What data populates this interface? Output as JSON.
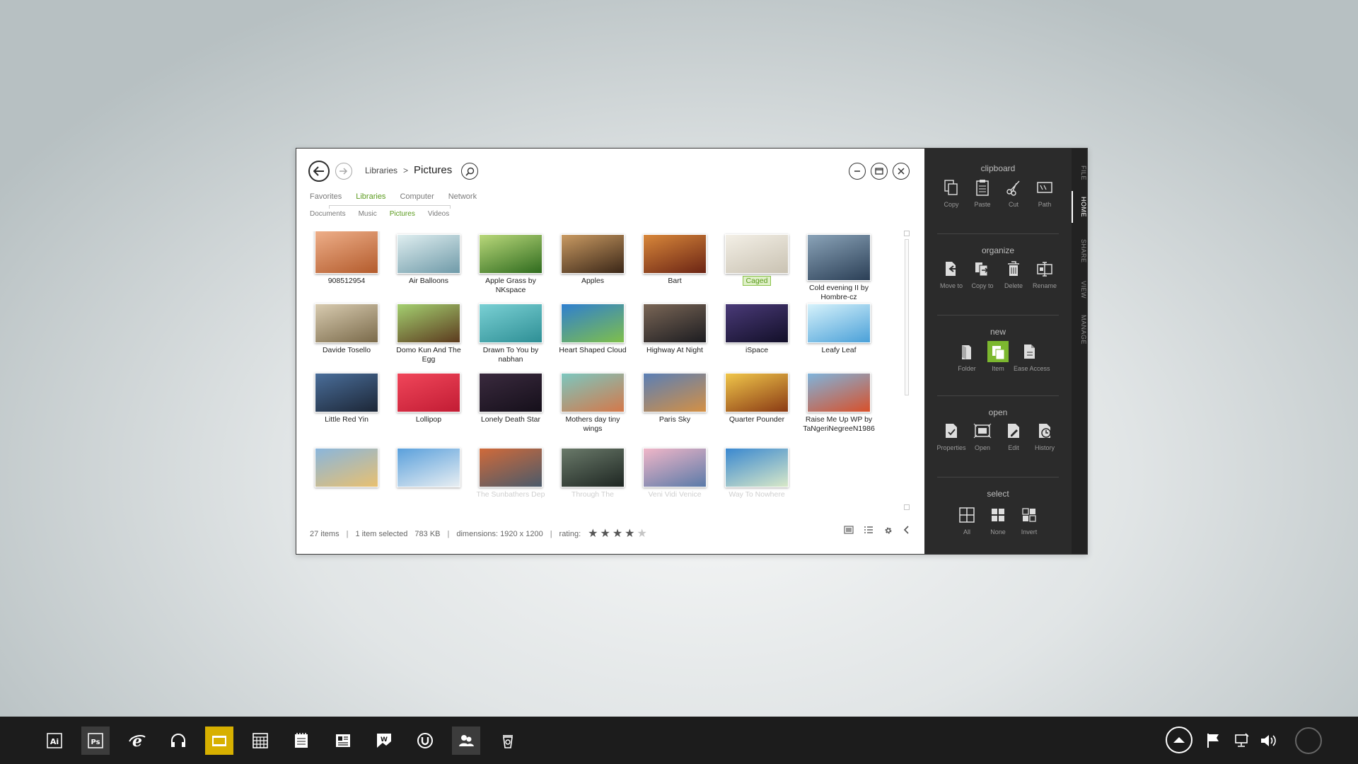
{
  "window": {
    "breadcrumb": {
      "root": "Libraries",
      "separator": ">",
      "current": "Pictures"
    },
    "tabs": [
      {
        "label": "Favorites",
        "active": false
      },
      {
        "label": "Libraries",
        "active": true
      },
      {
        "label": "Computer",
        "active": false
      },
      {
        "label": "Network",
        "active": false
      }
    ],
    "subtabs": [
      {
        "label": "Documents",
        "active": false
      },
      {
        "label": "Music",
        "active": false
      },
      {
        "label": "Pictures",
        "active": true
      },
      {
        "label": "Videos",
        "active": false
      }
    ],
    "items": [
      {
        "label": "908512954",
        "icon": "thumb-burgers",
        "colors": [
          "#f1b38e",
          "#b35b2c"
        ]
      },
      {
        "label": "Air Balloons",
        "icon": "thumb-air-balloons",
        "colors": [
          "#dfeef0",
          "#6f9aa8"
        ]
      },
      {
        "label": "Apple Grass by NKspace",
        "icon": "thumb-apple-grass",
        "colors": [
          "#b9d87a",
          "#2f6b1e"
        ]
      },
      {
        "label": "Apples",
        "icon": "thumb-apples",
        "colors": [
          "#c99a62",
          "#3a2617"
        ]
      },
      {
        "label": "Bart",
        "icon": "thumb-bart",
        "colors": [
          "#d8873a",
          "#6b2414"
        ]
      },
      {
        "label": "Caged",
        "icon": "thumb-caged",
        "colors": [
          "#f3efe6",
          "#c9c2b2"
        ],
        "selected": true
      },
      {
        "label": "Cold evening II by Hombre-cz",
        "icon": "thumb-cold-evening",
        "colors": [
          "#8aa3b8",
          "#2b3f56"
        ]
      },
      {
        "label": "Davide Tosello",
        "icon": "thumb-davide-tosello",
        "colors": [
          "#d8cbb0",
          "#7a6a4a"
        ]
      },
      {
        "label": "Domo Kun And The Egg",
        "icon": "thumb-domo-kun",
        "colors": [
          "#a4d070",
          "#5c3a1e"
        ]
      },
      {
        "label": "Drawn To You by nabhan",
        "icon": "thumb-drawn-to-you",
        "colors": [
          "#7ad0d4",
          "#2e8f95"
        ]
      },
      {
        "label": "Heart Shaped Cloud",
        "icon": "thumb-heart-cloud",
        "colors": [
          "#2f7fd0",
          "#7fbf4a"
        ]
      },
      {
        "label": "Highway At Night",
        "icon": "thumb-highway",
        "colors": [
          "#7a6656",
          "#1c1c20"
        ]
      },
      {
        "label": "iSpace",
        "icon": "thumb-ispace",
        "colors": [
          "#4a3a78",
          "#120f28"
        ]
      },
      {
        "label": "Leafy Leaf",
        "icon": "thumb-leafy-leaf",
        "colors": [
          "#d6f2fb",
          "#4aa0d8"
        ]
      },
      {
        "label": "Little Red Yin",
        "icon": "thumb-little-red-yin",
        "colors": [
          "#4a6e9a",
          "#1c2636"
        ]
      },
      {
        "label": "Lollipop",
        "icon": "thumb-lollipop",
        "colors": [
          "#f0465a",
          "#c21c34"
        ]
      },
      {
        "label": "Lonely Death Star",
        "icon": "thumb-death-star",
        "colors": [
          "#3a2a3e",
          "#150f1a"
        ]
      },
      {
        "label": "Mothers day tiny wings",
        "icon": "thumb-tiny-wings",
        "colors": [
          "#7cc7bf",
          "#d4784a"
        ]
      },
      {
        "label": "Paris Sky",
        "icon": "thumb-paris-sky",
        "colors": [
          "#5a7fb6",
          "#d49044"
        ]
      },
      {
        "label": "Quarter Pounder",
        "icon": "thumb-quarter-pounder",
        "colors": [
          "#f0c64a",
          "#8a3a14"
        ]
      },
      {
        "label": "Raise Me Up WP by TaNgeriNegreeN1986",
        "icon": "thumb-raise-me-up",
        "colors": [
          "#7fb4dc",
          "#d8502a"
        ]
      },
      {
        "label": "",
        "icon": "thumb-sunset-road",
        "colors": [
          "#8ab6dc",
          "#e8c070"
        ]
      },
      {
        "label": "",
        "icon": "thumb-flying-kid",
        "colors": [
          "#5aa0dc",
          "#e8eef2"
        ]
      },
      {
        "label": "The Sunbathers Dep",
        "icon": "thumb-sunbathers",
        "colors": [
          "#d06a3a",
          "#4a5a6a"
        ]
      },
      {
        "label": "Through The",
        "icon": "thumb-through-the",
        "colors": [
          "#6a7a6a",
          "#1e2622"
        ]
      },
      {
        "label": "Veni Vidi Venice",
        "icon": "thumb-venice",
        "colors": [
          "#f0b6c8",
          "#5a7aa8"
        ]
      },
      {
        "label": "Way To Nowhere",
        "icon": "thumb-way-to-nowhere",
        "colors": [
          "#3a88d0",
          "#d8e8c8"
        ]
      }
    ],
    "status": {
      "item_count": "27 items",
      "selection": "1 item selected",
      "size": "783 KB",
      "dimensions": "dimensions: 1920 x 1200",
      "rating_label": "rating:",
      "rating": 4,
      "rating_max": 5
    }
  },
  "ribbon": {
    "vertical_tabs": [
      {
        "label": "FILE",
        "active": false
      },
      {
        "label": "HOME",
        "active": true
      },
      {
        "label": "SHARE",
        "active": false
      },
      {
        "label": "VIEW",
        "active": false
      },
      {
        "label": "MANAGE",
        "active": false
      }
    ],
    "groups": [
      {
        "title": "clipboard",
        "items": [
          {
            "label": "Copy",
            "icon": "copy-icon"
          },
          {
            "label": "Paste",
            "icon": "paste-icon"
          },
          {
            "label": "Cut",
            "icon": "scissors-icon"
          },
          {
            "label": "Path",
            "icon": "path-icon"
          }
        ]
      },
      {
        "title": "organize",
        "items": [
          {
            "label": "Move to",
            "icon": "move-to-icon"
          },
          {
            "label": "Copy to",
            "icon": "copy-to-icon"
          },
          {
            "label": "Delete",
            "icon": "trash-icon"
          },
          {
            "label": "Rename",
            "icon": "rename-icon"
          }
        ]
      },
      {
        "title": "new",
        "items": [
          {
            "label": "Folder",
            "icon": "folder-icon"
          },
          {
            "label": "Item",
            "icon": "new-item-icon",
            "highlighted": true
          },
          {
            "label": "Ease Access",
            "icon": "ease-access-icon"
          }
        ]
      },
      {
        "title": "open",
        "items": [
          {
            "label": "Properties",
            "icon": "properties-icon"
          },
          {
            "label": "Open",
            "icon": "open-icon"
          },
          {
            "label": "Edit",
            "icon": "edit-icon"
          },
          {
            "label": "History",
            "icon": "history-icon"
          }
        ]
      },
      {
        "title": "select",
        "items": [
          {
            "label": "All",
            "icon": "select-all-icon"
          },
          {
            "label": "None",
            "icon": "select-none-icon"
          },
          {
            "label": "Invert",
            "icon": "select-invert-icon"
          }
        ]
      }
    ],
    "accent": "#7cb82f"
  },
  "taskbar": {
    "apps": [
      {
        "icon": "illustrator-icon",
        "text": "Ai",
        "state": "normal"
      },
      {
        "icon": "photoshop-icon",
        "text": "Ps",
        "state": "running"
      },
      {
        "icon": "internet-explorer-icon",
        "text": "",
        "state": "normal"
      },
      {
        "icon": "headphones-icon",
        "text": "",
        "state": "normal"
      },
      {
        "icon": "explorer-folder-icon",
        "text": "",
        "state": "active"
      },
      {
        "icon": "calculator-icon",
        "text": "",
        "state": "normal"
      },
      {
        "icon": "notepad-icon",
        "text": "",
        "state": "normal"
      },
      {
        "icon": "contacts-card-icon",
        "text": "",
        "state": "normal"
      },
      {
        "icon": "wordpad-image-icon",
        "text": "",
        "state": "normal"
      },
      {
        "icon": "utorrent-icon",
        "text": "",
        "state": "normal"
      },
      {
        "icon": "people-icon",
        "text": "",
        "state": "running"
      },
      {
        "icon": "recycle-bin-icon",
        "text": "",
        "state": "normal"
      }
    ],
    "tray": [
      {
        "icon": "action-center-flag-icon"
      },
      {
        "icon": "network-icon"
      },
      {
        "icon": "volume-icon"
      }
    ],
    "active_color": "#d7b000"
  }
}
